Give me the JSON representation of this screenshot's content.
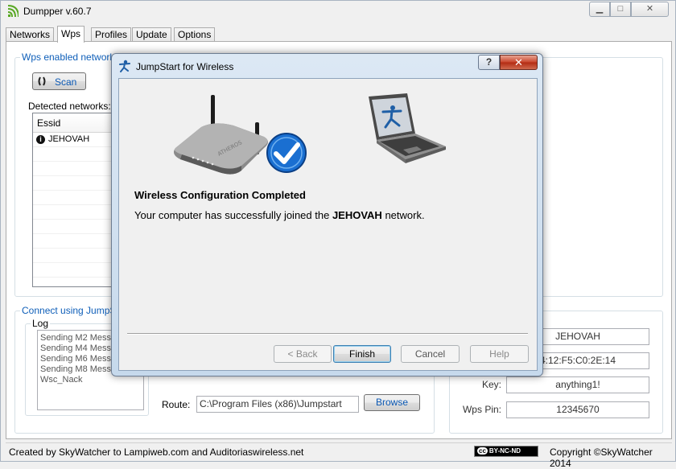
{
  "window": {
    "title": "Dumpper v.60.7",
    "min": "▁",
    "max": "□",
    "close": "✕"
  },
  "tabs": [
    {
      "label": "Networks"
    },
    {
      "label": "Wps"
    },
    {
      "label": "Profiles"
    },
    {
      "label": "Update"
    },
    {
      "label": "Options"
    }
  ],
  "wps_panel": {
    "group_title": "Wps enabled networks",
    "scan_label": "Scan",
    "detected_label": "Detected networks:",
    "column_essid": "Essid",
    "networks": [
      {
        "essid": "JEHOVAH"
      }
    ]
  },
  "jumpstart": {
    "group_title": "Connect using JumpStar",
    "log_title": "Log",
    "log_lines": [
      "Sending M2 Messag",
      "Sending M4 Messag",
      "Sending M6 Messag",
      "Sending M8 Messag",
      "Wsc_Nack"
    ],
    "route_label": "Route:",
    "route_value": "C:\\Program Files (x86)\\Jumpstart",
    "browse_label": "Browse"
  },
  "details": {
    "essid_value": "JEHOVAH",
    "bssid_value": "4:12:F5:C0:2E:14",
    "key_label": "Key:",
    "key_value": "anything1!",
    "pin_label": "Wps Pin:",
    "pin_value": "12345670"
  },
  "status": {
    "left": "Created by SkyWatcher to Lampiweb.com and Auditoriaswireless.net",
    "cc_mark": "cc",
    "cc_text": "BY-NC-ND",
    "right": "Copyright ©SkyWatcher 2014"
  },
  "dialog": {
    "title": "JumpStart for Wireless",
    "help": "?",
    "close": "✕",
    "heading": "Wireless Configuration Completed",
    "message_pre": "Your computer has successfully joined the ",
    "message_network": "JEHOVAH",
    "message_post": " network.",
    "router_brand": "ATHEROS",
    "buttons": {
      "back": "< Back",
      "finish": "Finish",
      "cancel": "Cancel",
      "help": "Help"
    }
  },
  "colors": {
    "accent_blue": "#0f5fb9",
    "close_red": "#c8432a",
    "check_blue": "#1a6fd1"
  }
}
